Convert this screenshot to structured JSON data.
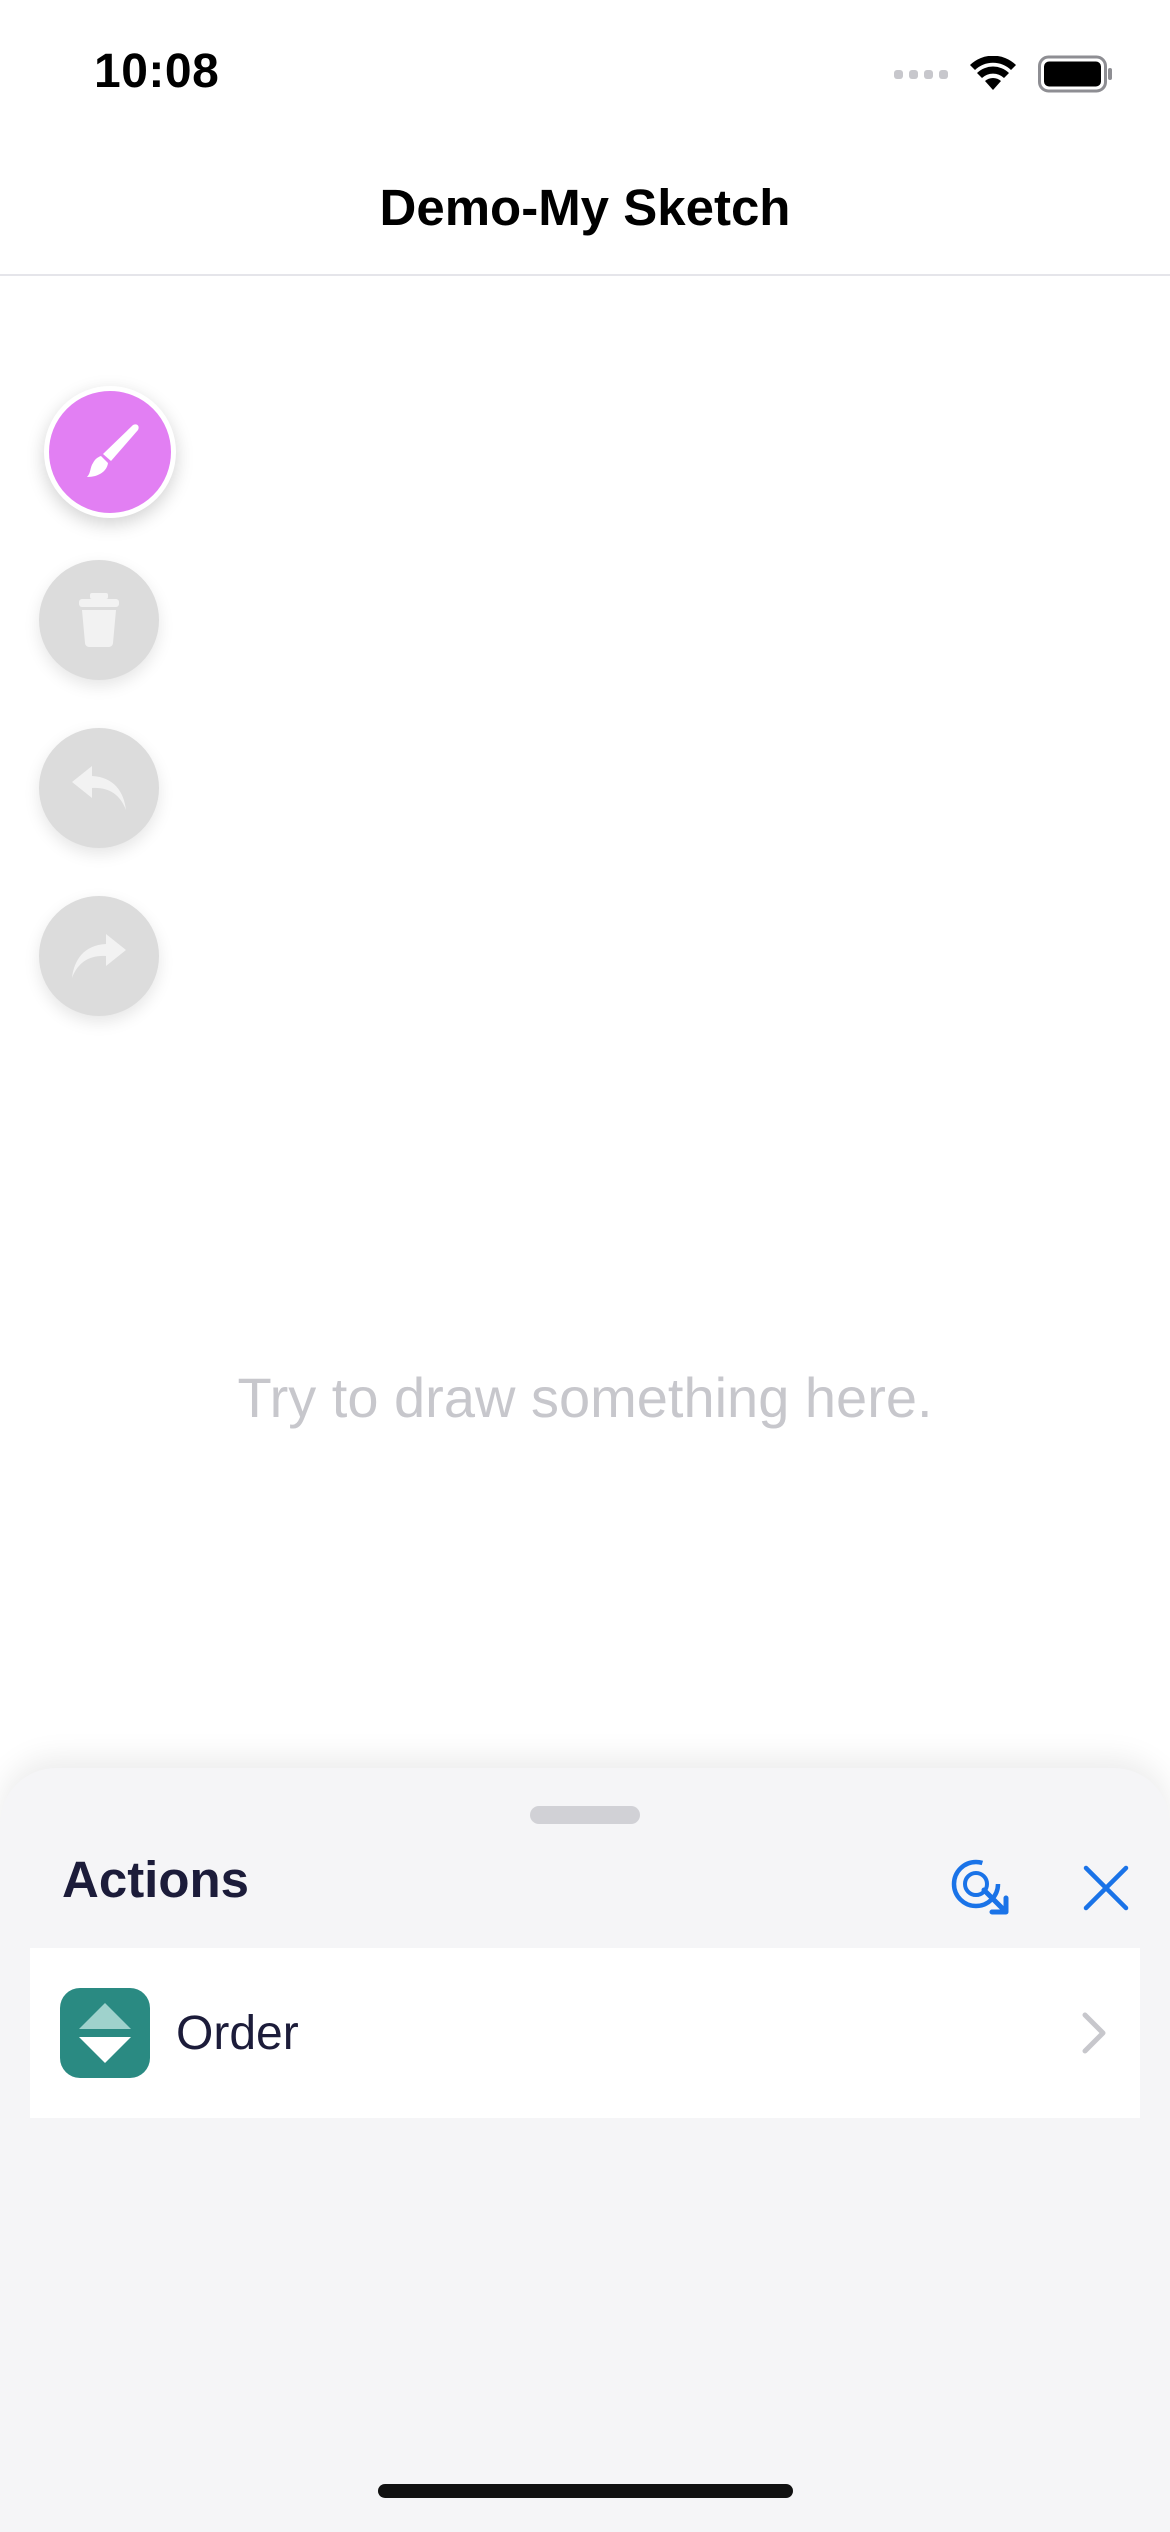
{
  "status": {
    "time": "10:08"
  },
  "nav": {
    "title": "Demo-My Sketch"
  },
  "tools": {
    "brush_icon": "paintbrush-icon",
    "trash_icon": "trash-icon",
    "undo_icon": "undo-arrow-icon",
    "redo_icon": "redo-arrow-icon",
    "active_color": "#e27ff3"
  },
  "canvas": {
    "hint": "Try to draw something here."
  },
  "sheet": {
    "title": "Actions",
    "refresh_icon": "refresh-icon",
    "close_icon": "close-icon",
    "actions": [
      {
        "label": "Order",
        "icon": "order-sort-icon",
        "icon_color": "#2a8a82"
      }
    ]
  }
}
